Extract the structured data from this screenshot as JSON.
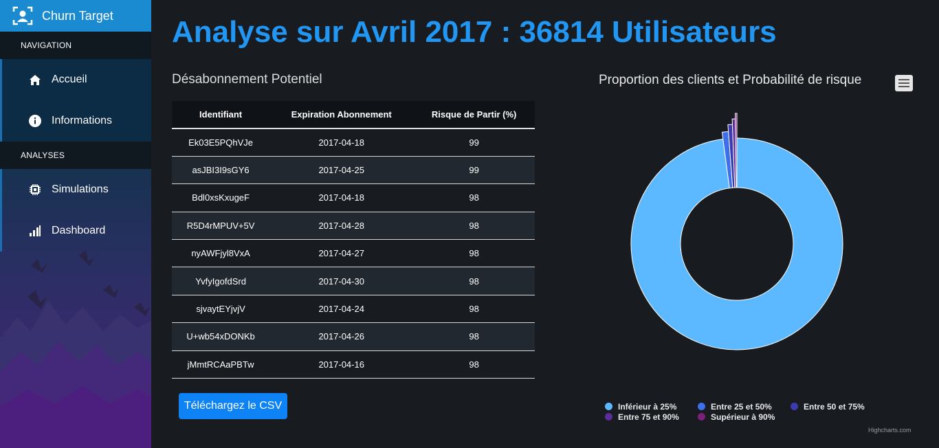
{
  "sidebar": {
    "brand": "Churn Target",
    "sections": [
      {
        "title": "NAVIGATION"
      },
      {
        "title": "ANALYSES"
      }
    ],
    "items": [
      {
        "label": "Accueil",
        "icon": "home-icon"
      },
      {
        "label": "Informations",
        "icon": "info-icon"
      },
      {
        "label": "Simulations",
        "icon": "chip-icon"
      },
      {
        "label": "Dashboard",
        "icon": "bar-chart-icon"
      }
    ]
  },
  "main": {
    "title": "Analyse sur Avril 2017 : 36814 Utilisateurs",
    "subtitle": "Désabonnement Potentiel",
    "table": {
      "headers": [
        "Identifiant",
        "Expiration Abonnement",
        "Risque de Partir (%)"
      ],
      "rows": [
        [
          "Ek03E5PQhVJe",
          "2017-04-18",
          "99"
        ],
        [
          "asJBI3I9sGY6",
          "2017-04-25",
          "99"
        ],
        [
          "Bdl0xsKxugeF",
          "2017-04-18",
          "98"
        ],
        [
          "R5D4rMPUV+5V",
          "2017-04-28",
          "98"
        ],
        [
          "nyAWFjyl8VxA",
          "2017-04-27",
          "98"
        ],
        [
          "YvfyIgofdSrd",
          "2017-04-30",
          "98"
        ],
        [
          "sjvaytEYjvjV",
          "2017-04-24",
          "98"
        ],
        [
          "U+wb54xDONKb",
          "2017-04-26",
          "98"
        ],
        [
          "jMmtRCAaPBTw",
          "2017-04-16",
          "98"
        ]
      ]
    },
    "csv_button": "Téléchargez le CSV"
  },
  "chart_data": {
    "type": "pie",
    "variant": "donut",
    "title": "Proportion des clients et Probabilité de risque",
    "series": [
      {
        "name": "Inférieur à 25%",
        "value": 97.9,
        "color": "#5cb8ff"
      },
      {
        "name": "Entre 25 et 50%",
        "value": 0.9,
        "color": "#3d6fe8"
      },
      {
        "name": "Entre 50 et 75%",
        "value": 0.6,
        "color": "#3b3bb0"
      },
      {
        "name": "Entre 75 et 90%",
        "value": 0.4,
        "color": "#5a2d9a"
      },
      {
        "name": "Supérieur à 90%",
        "value": 0.2,
        "color": "#7a1f7a"
      }
    ],
    "legend_position": "bottom",
    "credits": "Highcharts.com"
  },
  "colors": {
    "accent": "#2196f3",
    "button": "#0d83f5",
    "brand_bar": "#1a8bd0"
  }
}
